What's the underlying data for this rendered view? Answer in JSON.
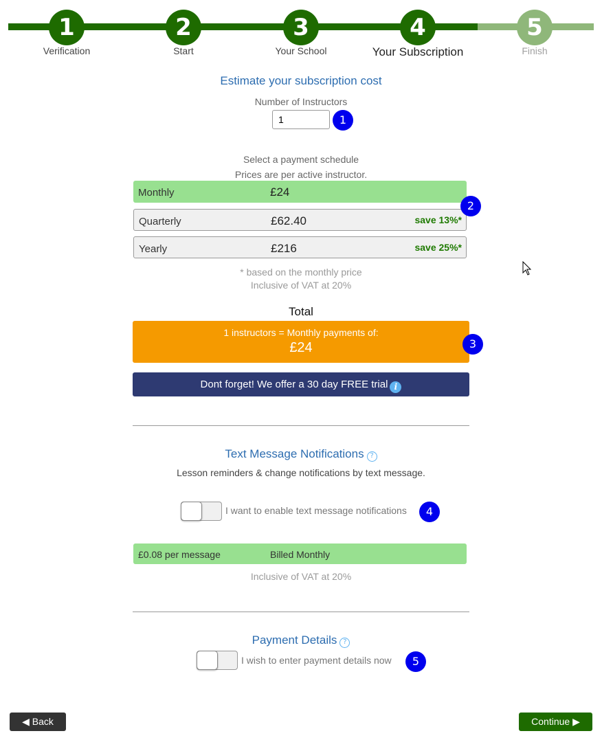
{
  "stepper": {
    "steps": [
      {
        "number": "1",
        "label": "Verification"
      },
      {
        "number": "2",
        "label": "Start"
      },
      {
        "number": "3",
        "label": "Your School"
      },
      {
        "number": "4",
        "label": "Your Subscription"
      },
      {
        "number": "5",
        "label": "Finish"
      }
    ],
    "current_step": 4
  },
  "estimate": {
    "title": "Estimate your subscription cost",
    "instructors_label": "Number of Instructors",
    "instructors_value": "1"
  },
  "schedule": {
    "title": "Select a payment schedule",
    "subtitle": "Prices are per active instructor.",
    "plans": [
      {
        "name": "Monthly",
        "price": "£24",
        "save": "",
        "selected": true
      },
      {
        "name": "Quarterly",
        "price": "£62.40",
        "save": "save 13%*",
        "selected": false
      },
      {
        "name": "Yearly",
        "price": "£216",
        "save": "save 25%*",
        "selected": false
      }
    ],
    "footnote": "* based on the monthly price",
    "vat": "Inclusive of VAT at 20%"
  },
  "total": {
    "heading": "Total",
    "summary": "1 instructors = Monthly payments of:",
    "amount": "£24"
  },
  "trial": {
    "text": "Dont forget! We offer a 30 day FREE trial",
    "info_icon": "i"
  },
  "sms": {
    "title": "Text Message Notifications",
    "description": "Lesson reminders & change notifications by text message.",
    "toggle_label": "I want to enable text message notifications",
    "toggle_on": false,
    "price": "£0.08 per message",
    "billing": "Billed Monthly",
    "vat": "Inclusive of VAT at 20%"
  },
  "payment": {
    "title": "Payment Details",
    "toggle_label": "I wish to enter payment details now",
    "toggle_on": false
  },
  "badges": [
    "1",
    "2",
    "3",
    "4",
    "5"
  ],
  "nav": {
    "back_label": "Back",
    "continue_label": "Continue"
  },
  "colors": {
    "step_done": "#1e6b00",
    "step_todo": "#8fb77a",
    "selected_plan": "#98e090",
    "total_box": "#f59a00",
    "trial_banner": "#2e3a72",
    "badge": "#0000ee",
    "heading_blue": "#2d6db0"
  }
}
